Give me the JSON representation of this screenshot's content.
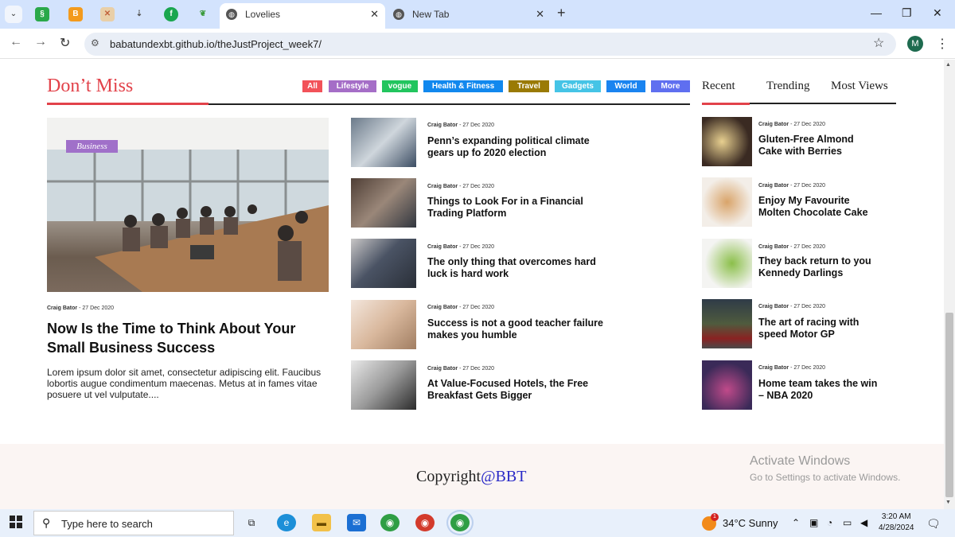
{
  "browser": {
    "tabs": [
      {
        "title": "Lovelies",
        "active": true
      },
      {
        "title": "New Tab",
        "active": false
      }
    ],
    "url": "babatundexbt.github.io/theJustProject_week7/",
    "profile_initial": "M",
    "pinned_icons": [
      "ms-icon",
      "blogger-icon",
      "cross-icon",
      "download-icon",
      "fi-icon",
      "leaf-icon"
    ]
  },
  "section": {
    "title": "Don’t Miss",
    "categories": [
      {
        "label": "All",
        "color": "#f25259"
      },
      {
        "label": "Lifestyle",
        "color": "#a56ec7"
      },
      {
        "label": "vogue",
        "color": "#22c55e"
      },
      {
        "label": "Health & Fitness",
        "color": "#1188ee"
      },
      {
        "label": "Travel",
        "color": "#9a7a04"
      },
      {
        "label": "Gadgets",
        "color": "#45c4e6"
      },
      {
        "label": "World",
        "color": "#1a84f0"
      },
      {
        "label": "More",
        "color": "#5f6ff0"
      }
    ],
    "right_tabs": [
      "Recent",
      "Trending",
      "Most Views"
    ]
  },
  "featured": {
    "badge": "Business",
    "author": "Craig Bator",
    "date": "27 Dec 2020",
    "title": "Now Is the Time to Think About Your Small Business Success",
    "excerpt": "Lorem ipsum dolor sit amet, consectetur adipiscing elit. Faucibus lobortis augue condimentum maecenas. Metus at in fames vitae posuere ut vel vulputate...."
  },
  "middle_posts": [
    {
      "author": "Craig Bator",
      "date": "27 Dec 2020",
      "title": "Penn’s expanding political climate gears up fo 2020 election"
    },
    {
      "author": "Craig Bator",
      "date": "27 Dec 2020",
      "title": "Things to Look For in a Financial Trading Platform"
    },
    {
      "author": "Craig Bator",
      "date": "27 Dec 2020",
      "title": "The only thing that overcomes hard luck is hard work"
    },
    {
      "author": "Craig Bator",
      "date": "27 Dec 2020",
      "title": "Success is not a good teacher failure makes you humble"
    },
    {
      "author": "Craig Bator",
      "date": "27 Dec 2020",
      "title": "At Value-Focused Hotels, the Free Breakfast Gets Bigger"
    }
  ],
  "right_posts": [
    {
      "author": "Craig Bator",
      "date": "27 Dec 2020",
      "title": "Gluten-Free Almond Cake with Berries"
    },
    {
      "author": "Craig Bator",
      "date": "27 Dec 2020",
      "title": "Enjoy My Favourite Molten Chocolate Cake"
    },
    {
      "author": "Craig Bator",
      "date": "27 Dec 2020",
      "title": "They back return to you Kennedy Darlings"
    },
    {
      "author": "Craig Bator",
      "date": "27 Dec 2020",
      "title": "The art of racing with speed Motor GP"
    },
    {
      "author": "Craig Bator",
      "date": "27 Dec 2020",
      "title": "Home team takes the win – NBA 2020"
    }
  ],
  "footer": {
    "copyright_prefix": "Copyright",
    "copyright_brand": "@BBT"
  },
  "watermark": {
    "line1": "Activate Windows",
    "line2": "Go to Settings to activate Windows."
  },
  "taskbar": {
    "search_placeholder": "Type here to search",
    "weather": "34°C  Sunny",
    "weather_badge": "1",
    "time": "3:20 AM",
    "date": "4/28/2024"
  }
}
